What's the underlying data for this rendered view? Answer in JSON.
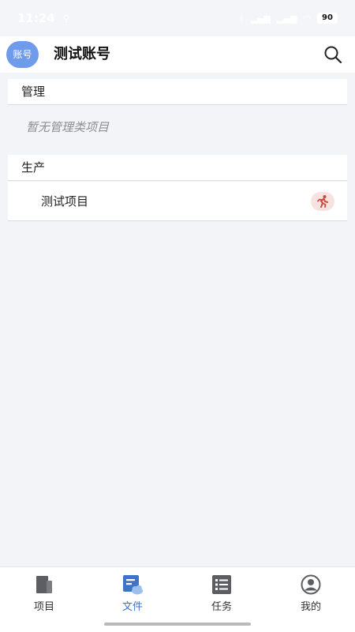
{
  "status_bar": {
    "time": "11:24",
    "battery": "90"
  },
  "header": {
    "avatar_text": "账号",
    "title": "测试账号",
    "search_icon": "search-icon"
  },
  "sections": {
    "management": {
      "title": "管理",
      "empty_text": "暂无管理类项目"
    },
    "production": {
      "title": "生产",
      "items": [
        {
          "label": "测试项目",
          "icon": "running-person-icon"
        }
      ]
    }
  },
  "bottom_nav": {
    "items": [
      {
        "label": "项目",
        "icon": "document-icon",
        "active": false
      },
      {
        "label": "文件",
        "icon": "file-cloud-icon",
        "active": true
      },
      {
        "label": "任务",
        "icon": "task-list-icon",
        "active": false
      },
      {
        "label": "我的",
        "icon": "profile-icon",
        "active": false
      }
    ]
  },
  "colors": {
    "accent": "#3f73c7",
    "avatar": "#6e9bea",
    "badge_bg": "#f6e3e1",
    "badge_icon": "#c94b3c",
    "page_bg": "#f3f4f8"
  }
}
